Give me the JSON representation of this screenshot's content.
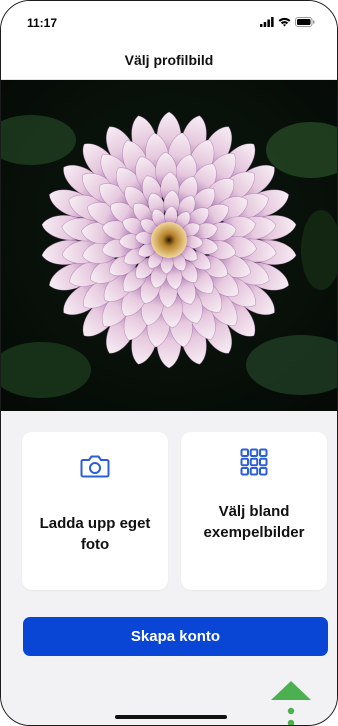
{
  "status_bar": {
    "time": "11:17"
  },
  "header": {
    "title": "Välj profilbild"
  },
  "options": {
    "upload": {
      "label": "Ladda upp eget foto",
      "icon": "camera-icon"
    },
    "examples": {
      "label": "Välj bland exempelbilder",
      "icon": "grid-icon"
    }
  },
  "actions": {
    "create_account_label": "Skapa konto"
  },
  "colors": {
    "accent": "#0a46d6",
    "icon_blue": "#2b5fd9",
    "hint_green": "#4caf50",
    "background": "#f2f2f4"
  }
}
